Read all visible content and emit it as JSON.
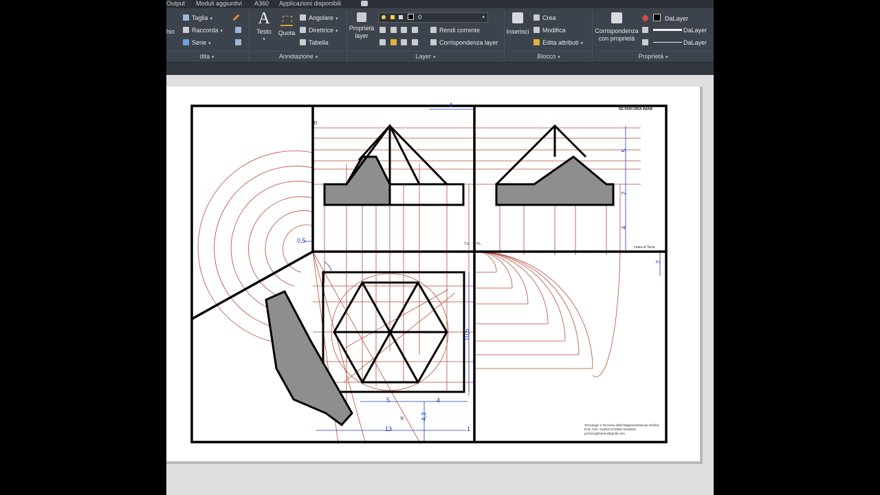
{
  "menubar": {
    "items": [
      "Output",
      "Moduli aggiuntivi",
      "A360",
      "Applicazioni disponibili"
    ]
  },
  "ribbon": {
    "modifica": {
      "taglia": "Taglia",
      "raccorda": "Raccorda",
      "serie": "Serie",
      "partial_left": "hio",
      "group_label_partial": "dita"
    },
    "annotazione": {
      "testo": "Testo",
      "quota": "Quota",
      "angolare": "Angolare",
      "direttrice": "Direttrice",
      "tabella": "Tabella",
      "group_label": "Annotazione"
    },
    "layer": {
      "proprieta_layer": "Proprietà layer",
      "current_layer": "0",
      "rendi_corrente": "Rendi corrente",
      "corrispondenza_layer": "Corrispondenza layer",
      "group_label": "Layer"
    },
    "blocco": {
      "inserisci": "Inserisci",
      "crea": "Crea",
      "modifica": "Modifica",
      "edita_attributi": "Edita attributi",
      "group_label": "Blocco"
    },
    "proprieta": {
      "corrispondenza": "Corrispondenza con proprietà",
      "color": "DaLayer",
      "lineweight": "DaLayer",
      "linetype": "DaLayer",
      "group_label": "Proprietà"
    }
  },
  "drawing": {
    "dimensions": {
      "top_width": "4",
      "right_h1": "5",
      "right_h2": "2",
      "right_h3": "4",
      "right_gap": "2",
      "left_offset": "0,5",
      "height_105": "10,5",
      "bottom_5": "5",
      "bottom_4": "4",
      "bottom_13": "13",
      "bottom_1": "1",
      "vertical_43": "4,3"
    },
    "labels": {
      "pi_top": "π",
      "pi_bottom": "π",
      "tv": "T.V.",
      "pl": "P.L.",
      "linea_di_terra": "Linea di Terra",
      "corner_title": "DE PARI DIRA INIAM"
    },
    "title_block": {
      "line1": "Tecnologie e Tecniche della Rappresentazione Grafica",
      "line2": "Prof. Arch. GUIDO DADINO MARINO",
      "line3": "prof.arcgtimarino@gmail.com"
    }
  },
  "colors": {
    "ribbon_bg": "#3d434c",
    "sheet_bg": "#ffffff",
    "construction_line": "#b5483a",
    "dimension": "#1a36c7",
    "section_fill": "#8e8e8e"
  }
}
